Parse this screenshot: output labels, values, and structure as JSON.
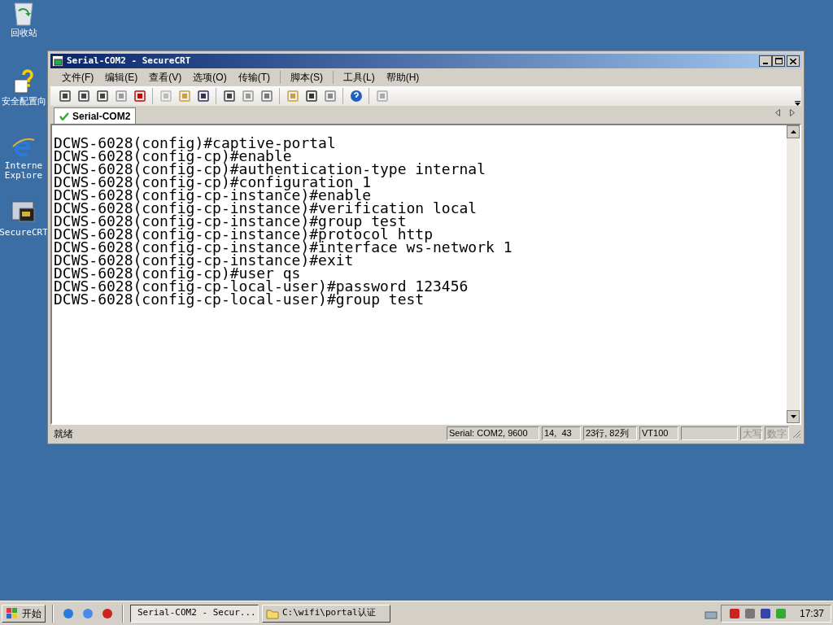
{
  "desktop_icons": [
    {
      "kind": "recycle",
      "label": "回收站"
    },
    {
      "kind": "help",
      "label": "安全配置向"
    },
    {
      "kind": "ie",
      "label": "Interne\nExplore"
    },
    {
      "kind": "crt",
      "label": "SecureCRT"
    }
  ],
  "window": {
    "title": "Serial-COM2 - SecureCRT"
  },
  "menu": [
    "文件(F)",
    "编辑(E)",
    "查看(V)",
    "选项(O)",
    "传输(T)",
    "脚本(S)",
    "工具(L)",
    "帮助(H)"
  ],
  "tabs": [
    {
      "label": "Serial-COM2",
      "selected": true
    }
  ],
  "terminal_lines": [
    "DCWS-6028(config)#captive-portal",
    "DCWS-6028(config-cp)#enable",
    "DCWS-6028(config-cp)#authentication-type internal",
    "DCWS-6028(config-cp)#configuration 1",
    "DCWS-6028(config-cp-instance)#enable",
    "DCWS-6028(config-cp-instance)#verification local",
    "DCWS-6028(config-cp-instance)#group test",
    "DCWS-6028(config-cp-instance)#protocol http",
    "DCWS-6028(config-cp-instance)#interface ws-network 1",
    "DCWS-6028(config-cp-instance)#exit",
    "DCWS-6028(config-cp)#user qs",
    "DCWS-6028(config-cp-local-user)#password 123456",
    "DCWS-6028(config-cp-local-user)#group test"
  ],
  "status_bar": {
    "message": "就绪",
    "panes": [
      {
        "text": "Serial: COM2, 9600",
        "disabled": false
      },
      {
        "text": "14,  43",
        "disabled": false
      },
      {
        "text": "23行, 82列",
        "disabled": false
      },
      {
        "text": "VT100",
        "disabled": false
      },
      {
        "kind": "blank"
      },
      {
        "text": "大写",
        "disabled": true
      },
      {
        "text": "数字",
        "disabled": true
      }
    ]
  },
  "taskbar": {
    "start": "开始",
    "tasks": [
      {
        "kind": "crt",
        "label": "Serial-COM2 - Secur...",
        "selected": true
      },
      {
        "kind": "folder",
        "label": "C:\\wifi\\portal认证",
        "selected": false
      }
    ],
    "clock": "17:37"
  }
}
